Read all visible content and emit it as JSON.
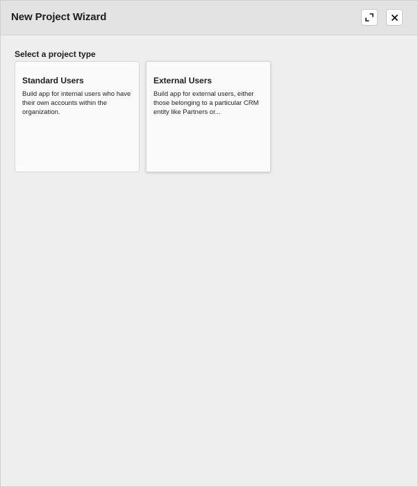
{
  "dialog": {
    "title": "New Project Wizard",
    "icons": {
      "expand": "expand-icon",
      "close": "close-icon"
    }
  },
  "main": {
    "section_label": "Select a project type",
    "cards": [
      {
        "title": "Standard Users",
        "description": "Build app for internal users who have their own accounts within the organization."
      },
      {
        "title": "External Users",
        "description": "Build app for external users, either those belonging to a particular CRM entity like Partners or..."
      }
    ]
  },
  "colors": {
    "header_bg": "#e3e3e3",
    "body_bg": "#eeeeee",
    "card_bg": "#fafafa"
  }
}
